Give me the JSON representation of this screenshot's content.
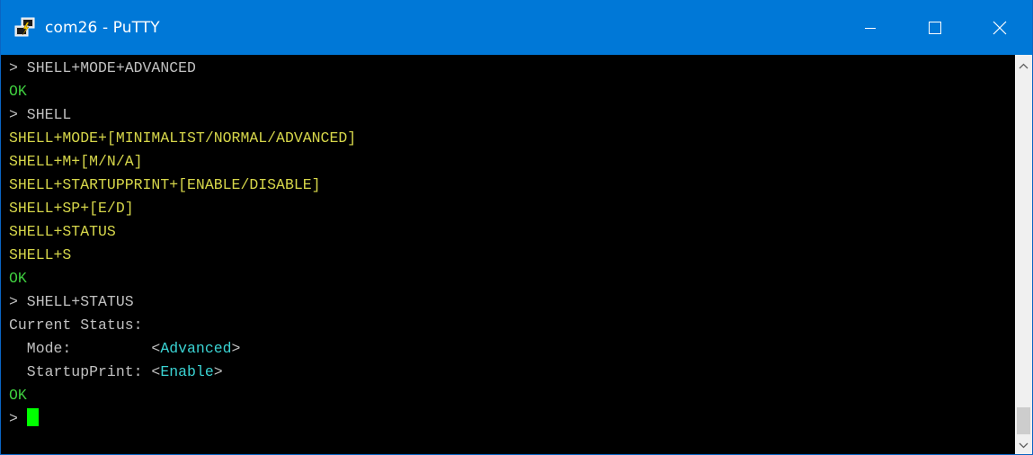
{
  "window": {
    "title": "com26 - PuTTY",
    "app_icon": "putty-icon",
    "controls": {
      "minimize": "minimize-icon",
      "maximize": "maximize-icon",
      "close": "close-icon"
    },
    "colors": {
      "titlebar": "#0078d7",
      "terminal_background": "#000000"
    }
  },
  "terminal": {
    "lines": [
      {
        "segments": [
          {
            "text": "> SHELL+MODE+ADVANCED",
            "color": "#c0c0c0"
          }
        ]
      },
      {
        "segments": [
          {
            "text": "OK",
            "color": "#3fce3f"
          }
        ]
      },
      {
        "segments": [
          {
            "text": "> SHELL",
            "color": "#c0c0c0"
          }
        ]
      },
      {
        "segments": [
          {
            "text": "SHELL+MODE+[MINIMALIST/NORMAL/ADVANCED]",
            "color": "#d6d64a"
          }
        ]
      },
      {
        "segments": [
          {
            "text": "SHELL+M+[M/N/A]",
            "color": "#d6d64a"
          }
        ]
      },
      {
        "segments": [
          {
            "text": "SHELL+STARTUPPRINT+[ENABLE/DISABLE]",
            "color": "#d6d64a"
          }
        ]
      },
      {
        "segments": [
          {
            "text": "SHELL+SP+[E/D]",
            "color": "#d6d64a"
          }
        ]
      },
      {
        "segments": [
          {
            "text": "SHELL+STATUS",
            "color": "#d6d64a"
          }
        ]
      },
      {
        "segments": [
          {
            "text": "SHELL+S",
            "color": "#d6d64a"
          }
        ]
      },
      {
        "segments": [
          {
            "text": "OK",
            "color": "#3fce3f"
          }
        ]
      },
      {
        "segments": [
          {
            "text": "> SHELL+STATUS",
            "color": "#c0c0c0"
          }
        ]
      },
      {
        "segments": [
          {
            "text": "Current Status:",
            "color": "#c0c0c0"
          }
        ]
      },
      {
        "segments": [
          {
            "text": "  Mode:         <",
            "color": "#c0c0c0"
          },
          {
            "text": "Advanced",
            "color": "#3ad2d2"
          },
          {
            "text": ">",
            "color": "#c0c0c0"
          }
        ]
      },
      {
        "segments": [
          {
            "text": "  StartupPrint: <",
            "color": "#c0c0c0"
          },
          {
            "text": "Enable",
            "color": "#3ad2d2"
          },
          {
            "text": ">",
            "color": "#c0c0c0"
          }
        ]
      },
      {
        "segments": [
          {
            "text": "OK",
            "color": "#3fce3f"
          }
        ]
      },
      {
        "segments": [
          {
            "text": "> ",
            "color": "#c0c0c0"
          }
        ],
        "cursor": true
      }
    ],
    "cursor_color": "#00ff00"
  },
  "scrollbar": {
    "up": "chevron-up-icon",
    "down": "chevron-down-icon"
  }
}
